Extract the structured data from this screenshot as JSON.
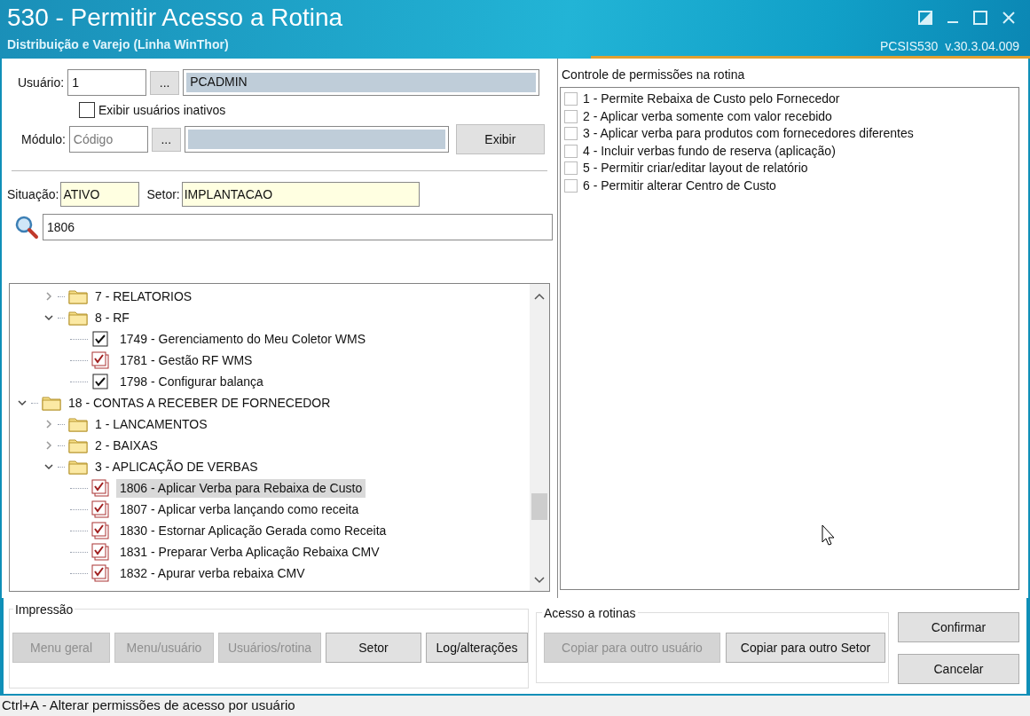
{
  "window": {
    "title": "530 - Permitir Acesso a Rotina",
    "subtitle": "Distribuição e Varejo (Linha WinThor)",
    "version": "PCSIS530  v.30.3.04.009"
  },
  "user": {
    "label": "Usuário:",
    "code": "1",
    "lookup": "...",
    "name": "PCADMIN"
  },
  "inactive": {
    "label": "Exibir usuários inativos",
    "checked": false
  },
  "module": {
    "label": "Módulo:",
    "placeholder": "Código",
    "lookup": "...",
    "button": "Exibir"
  },
  "situation": {
    "label": "Situação:",
    "value": "ATIVO"
  },
  "sector": {
    "label": "Setor:",
    "value": "IMPLANTACAO"
  },
  "search": {
    "value": "1806"
  },
  "tree": {
    "items": [
      {
        "children": [
          {
            "label": "7 - RELATORIOS",
            "expanded": false
          },
          {
            "label": "8 - RF",
            "expanded": true,
            "children": [
              {
                "label": "1749 - Gerenciamento do Meu Coletor WMS",
                "kind": "single",
                "selected": false
              },
              {
                "label": "1781 - Gestão RF WMS",
                "kind": "multi",
                "selected": false
              },
              {
                "label": "1798 - Configurar balança",
                "kind": "single",
                "selected": false
              }
            ]
          }
        ]
      },
      {
        "label": "18 - CONTAS A RECEBER DE FORNECEDOR",
        "expanded": true,
        "children": [
          {
            "label": "1 - LANCAMENTOS",
            "expanded": false
          },
          {
            "label": "2 - BAIXAS",
            "expanded": false
          },
          {
            "label": "3 - APLICAÇÃO DE VERBAS",
            "expanded": true,
            "children": [
              {
                "label": "1806 - Aplicar Verba para Rebaixa de Custo",
                "kind": "multi",
                "selected": true
              },
              {
                "label": "1807 - Aplicar verba lançando como receita",
                "kind": "multi",
                "selected": false
              },
              {
                "label": "1830 - Estornar Aplicação Gerada como Receita",
                "kind": "multi",
                "selected": false
              },
              {
                "label": "1831 - Preparar Verba Aplicação Rebaixa CMV",
                "kind": "multi",
                "selected": false
              },
              {
                "label": "1832 - Apurar verba rebaixa CMV",
                "kind": "multi",
                "selected": false
              }
            ]
          }
        ]
      }
    ]
  },
  "permissions": {
    "title": "Controle de permissões na rotina",
    "items": [
      {
        "label": "1 - Permite Rebaixa de Custo pelo Fornecedor",
        "checked": false
      },
      {
        "label": "2 - Aplicar verba somente com valor recebido",
        "checked": false
      },
      {
        "label": "3 - Aplicar verba para produtos com fornecedores diferentes",
        "checked": false
      },
      {
        "label": "4 - Incluir verbas fundo de reserva (aplicação)",
        "checked": false
      },
      {
        "label": "5 - Permitir criar/editar layout de relatório",
        "checked": false
      },
      {
        "label": "6 - Permitir alterar Centro de Custo",
        "checked": false
      }
    ]
  },
  "printing": {
    "title": "Impressão",
    "buttons": [
      {
        "label": "Menu geral",
        "disabled": true
      },
      {
        "label": "Menu/usuário",
        "disabled": true
      },
      {
        "label": "Usuários/rotina",
        "disabled": true
      },
      {
        "label": "Setor",
        "disabled": false
      },
      {
        "label": "Log/alterações",
        "disabled": false
      }
    ]
  },
  "access": {
    "title": "Acesso a rotinas",
    "buttons": [
      {
        "label": "Copiar para outro usuário",
        "disabled": true
      },
      {
        "label": "Copiar para outro Setor",
        "disabled": false
      }
    ]
  },
  "actions": [
    {
      "label": "Confirmar"
    },
    {
      "label": "Cancelar"
    }
  ],
  "status_bar": "Ctrl+A - Alterar permissões de acesso por usuário"
}
